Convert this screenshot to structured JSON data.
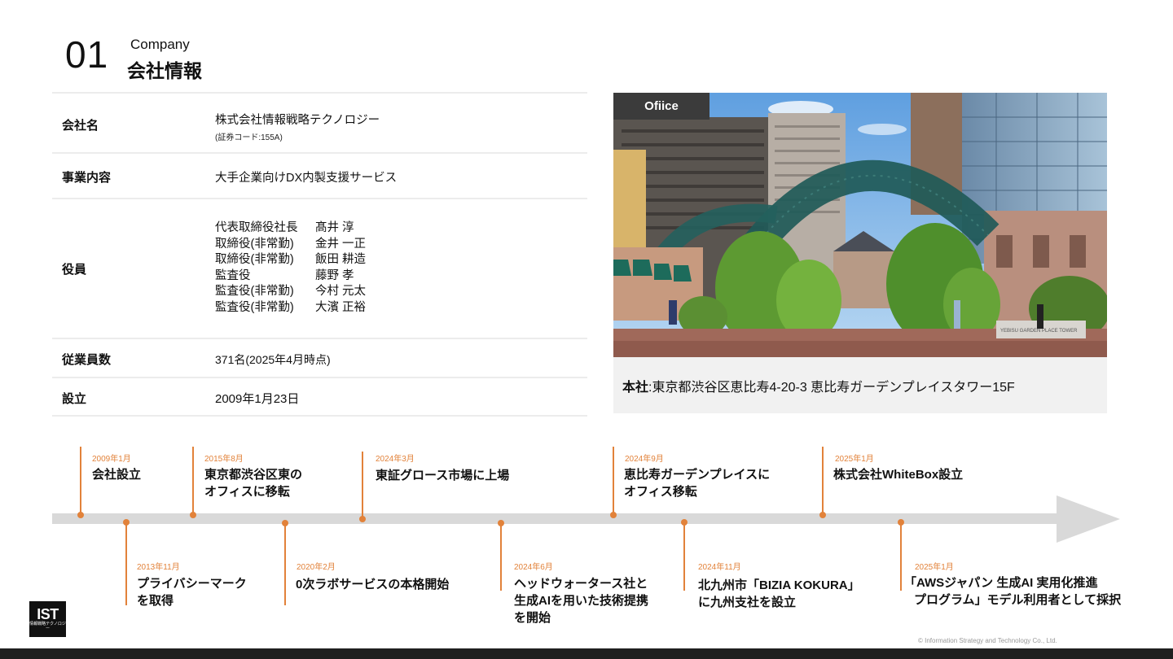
{
  "header": {
    "number": "01",
    "title_en": "Company",
    "title_jp": "会社情報"
  },
  "company": {
    "name_label": "会社名",
    "name_value": "株式会社情報戦略テクノロジー",
    "name_sub": "(証券コード:155A)",
    "business_label": "事業内容",
    "business_value": "大手企業向けDX内製支援サービス",
    "officers_label": "役員",
    "officers": [
      {
        "role": "代表取締役社長",
        "name": "髙井 淳"
      },
      {
        "role": "取締役(非常勤)",
        "name": "金井 一正"
      },
      {
        "role": "取締役(非常勤)",
        "name": "飯田 耕造"
      },
      {
        "role": "監査役",
        "name": "藤野 孝"
      },
      {
        "role": "監査役(非常勤)",
        "name": "今村 元太"
      },
      {
        "role": "監査役(非常勤)",
        "name": "大濱 正裕"
      }
    ],
    "employees_label": "従業員数",
    "employees_value": "371名(2025年4月時点)",
    "founded_label": "設立",
    "founded_value": "2009年1月23日"
  },
  "office": {
    "tag": "Ofiice",
    "address_label": "本社",
    "address_value": ":東京都渋谷区恵比寿4-20-3 恵比寿ガーデンプレイスタワー15F",
    "sign_text": "YEBISU GARDEN PLACE TOWER"
  },
  "timeline": {
    "above": [
      {
        "date": "2009年1月",
        "line1": "会社設立",
        "line2": ""
      },
      {
        "date": "2015年8月",
        "line1": "東京都渋谷区東の",
        "line2": "オフィスに移転"
      },
      {
        "date": "2024年3月",
        "line1": "東証グロース市場に上場",
        "line2": ""
      },
      {
        "date": "2024年9月",
        "line1": "恵比寿ガーデンプレイスに",
        "line2": "オフィス移転"
      },
      {
        "date": "2025年1月",
        "line1": "株式会社WhiteBox設立",
        "line2": ""
      }
    ],
    "below": [
      {
        "date": "2013年11月",
        "line1": "プライバシーマーク",
        "line2": "を取得",
        "line3": ""
      },
      {
        "date": "2020年2月",
        "line1": "0次ラボサービスの本格開始",
        "line2": "",
        "line3": ""
      },
      {
        "date": "2024年6月",
        "line1": "ヘッドウォータース社と",
        "line2": "生成AIを用いた技術提携",
        "line3": "を開始"
      },
      {
        "date": "2024年11月",
        "line1": "北九州市「BIZIA KOKURA」",
        "line2": "に九州支社を設立",
        "line3": ""
      },
      {
        "date": "2025年1月",
        "line1": "「AWSジャパン 生成AI 実用化推進",
        "line2": "プログラム」モデル利用者として採択",
        "line3": ""
      }
    ]
  },
  "footer": {
    "logo_text": "IST",
    "logo_sub": "情報戦略テクノロジー",
    "copyright": "© Information Strategy and Technology Co., Ltd."
  }
}
